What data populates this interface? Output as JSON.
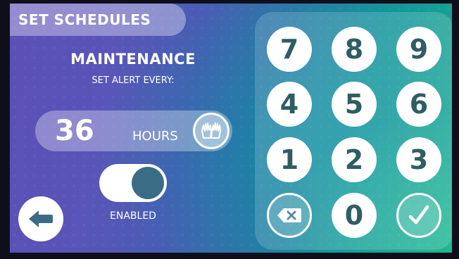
{
  "header": {
    "title": "SET SCHEDULES"
  },
  "maintenance": {
    "title": "MAINTENANCE",
    "subtitle": "SET ALERT EVERY:",
    "value": "36",
    "unit": "HOURS"
  },
  "toggle": {
    "label": "ENABLED",
    "state": "on"
  },
  "keypad": {
    "keys": [
      "7",
      "8",
      "9",
      "4",
      "5",
      "6",
      "1",
      "2",
      "3",
      "0"
    ],
    "backspace_icon": "backspace-icon",
    "confirm_icon": "checkmark-icon"
  },
  "icons": {
    "gloves": "gloves-icon",
    "back": "arrow-left-icon"
  },
  "colors": {
    "key_text": "#2f5e62",
    "toggle_knob": "#3a6c86"
  }
}
